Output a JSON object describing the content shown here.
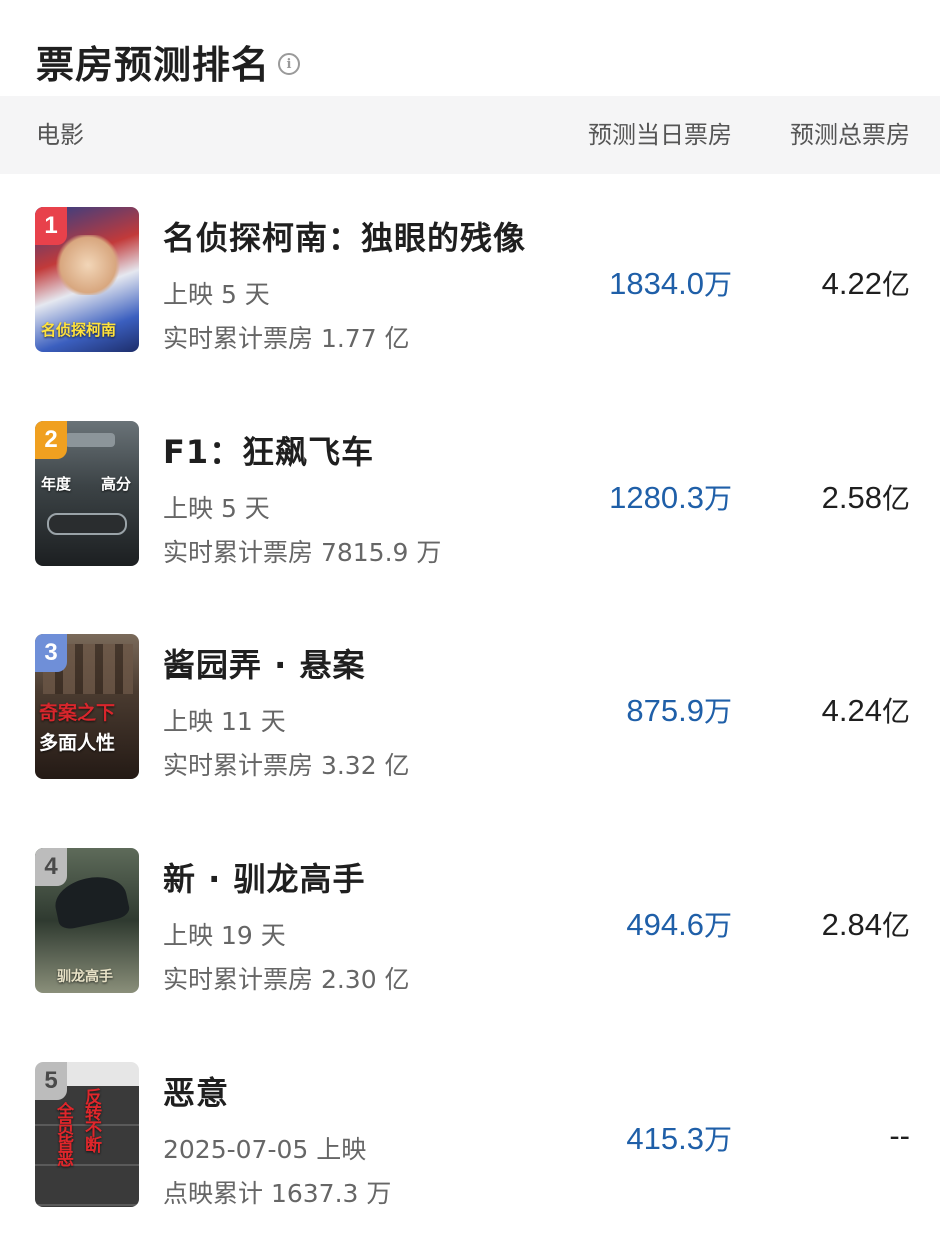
{
  "page": {
    "title": "票房预测排名"
  },
  "table": {
    "headers": {
      "movie": "电影",
      "daily": "预测当日票房",
      "total": "预测总票房"
    },
    "rows": [
      {
        "rank": "1",
        "title": "名侦探柯南：独眼的残像",
        "meta1": "上映 5 天",
        "meta2": "实时累计票房 1.77 亿",
        "daily_value": "1834.0",
        "daily_unit": "万",
        "total_value": "4.22",
        "total_unit": "亿",
        "badge_color": "#e8414b",
        "poster_text_1": "名侦探柯南",
        "poster_text_2": ""
      },
      {
        "rank": "2",
        "title": "F1：狂飙飞车",
        "meta1": "上映 5 天",
        "meta2": "实时累计票房 7815.9 万",
        "daily_value": "1280.3",
        "daily_unit": "万",
        "total_value": "2.58",
        "total_unit": "亿",
        "badge_color": "#f0a020",
        "poster_text_1": "年度",
        "poster_text_2": "高分"
      },
      {
        "rank": "3",
        "title": "酱园弄 · 悬案",
        "meta1": "上映 11 天",
        "meta2": "实时累计票房 3.32 亿",
        "daily_value": "875.9",
        "daily_unit": "万",
        "total_value": "4.24",
        "total_unit": "亿",
        "badge_color": "#6f8fd8",
        "poster_text_1": "奇案之下",
        "poster_text_2": "多面人性"
      },
      {
        "rank": "4",
        "title": "新 · 驯龙高手",
        "meta1": "上映 19 天",
        "meta2": "实时累计票房 2.30 亿",
        "daily_value": "494.6",
        "daily_unit": "万",
        "total_value": "2.84",
        "total_unit": "亿",
        "badge_color": "#bcbcbc",
        "poster_text_1": "驯龙高手",
        "poster_text_2": ""
      },
      {
        "rank": "5",
        "title": "恶意",
        "meta1": "2025-07-05 上映",
        "meta2": "点映累计 1637.3 万",
        "daily_value": "415.3",
        "daily_unit": "万",
        "total_value": "--",
        "total_unit": "",
        "badge_color": "#bcbcbc",
        "poster_text_1": "反转不断",
        "poster_text_2": "全员皆恶"
      }
    ]
  }
}
